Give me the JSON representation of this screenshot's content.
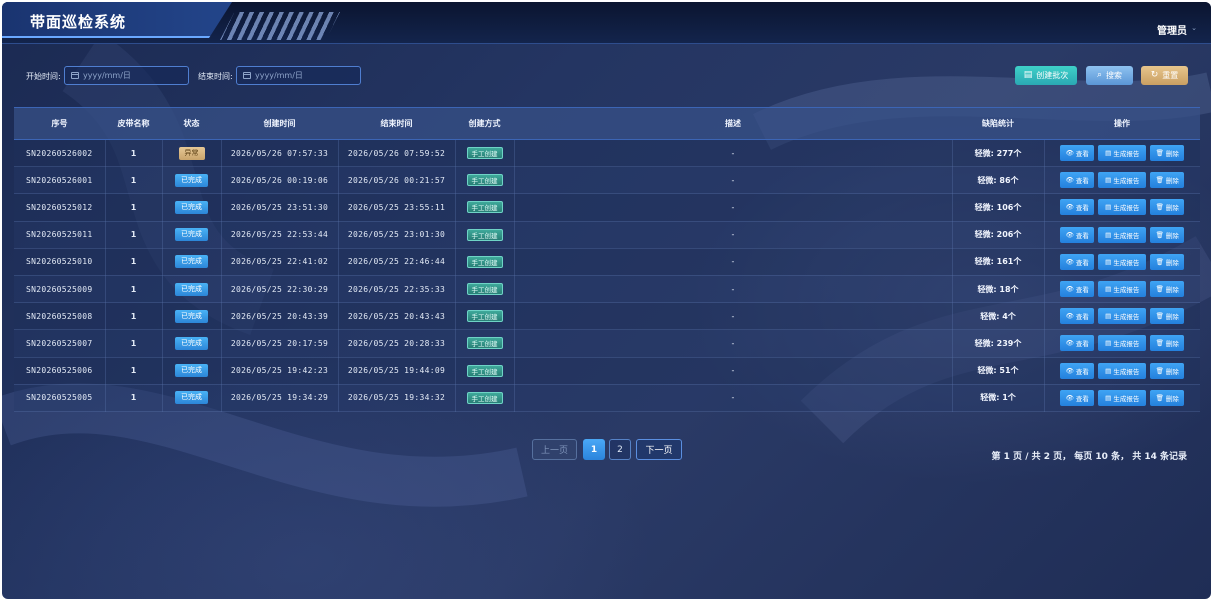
{
  "header": {
    "title": "带面巡检系统",
    "user": "管理员"
  },
  "filters": {
    "start_label": "开始时间:",
    "start_placeholder": "yyyy/mm/日",
    "end_label": "结束时间:",
    "end_placeholder": "yyyy/mm/日"
  },
  "toolbar": {
    "create_label": "创建批次",
    "search_label": "搜索",
    "reset_label": "重置"
  },
  "table": {
    "columns": [
      "序号",
      "皮带名称",
      "状态",
      "创建时间",
      "结束时间",
      "创建方式",
      "描述",
      "缺陷统计",
      "操作"
    ],
    "rows": [
      {
        "id": "SN20260526002",
        "belt": "1",
        "status": "异常",
        "status_type": "error",
        "created": "2026/05/26 07:57:33",
        "ended": "2026/05/26 07:59:52",
        "method": "手工创建",
        "desc": "-",
        "defects": "轻微: 277个"
      },
      {
        "id": "SN20260526001",
        "belt": "1",
        "status": "已完成",
        "status_type": "done",
        "created": "2026/05/26 00:19:06",
        "ended": "2026/05/26 00:21:57",
        "method": "手工创建",
        "desc": "-",
        "defects": "轻微: 86个"
      },
      {
        "id": "SN20260525012",
        "belt": "1",
        "status": "已完成",
        "status_type": "done",
        "created": "2026/05/25 23:51:30",
        "ended": "2026/05/25 23:55:11",
        "method": "手工创建",
        "desc": "-",
        "defects": "轻微: 106个"
      },
      {
        "id": "SN20260525011",
        "belt": "1",
        "status": "已完成",
        "status_type": "done",
        "created": "2026/05/25 22:53:44",
        "ended": "2026/05/25 23:01:30",
        "method": "手工创建",
        "desc": "-",
        "defects": "轻微: 206个"
      },
      {
        "id": "SN20260525010",
        "belt": "1",
        "status": "已完成",
        "status_type": "done",
        "created": "2026/05/25 22:41:02",
        "ended": "2026/05/25 22:46:44",
        "method": "手工创建",
        "desc": "-",
        "defects": "轻微: 161个"
      },
      {
        "id": "SN20260525009",
        "belt": "1",
        "status": "已完成",
        "status_type": "done",
        "created": "2026/05/25 22:30:29",
        "ended": "2026/05/25 22:35:33",
        "method": "手工创建",
        "desc": "-",
        "defects": "轻微: 18个"
      },
      {
        "id": "SN20260525008",
        "belt": "1",
        "status": "已完成",
        "status_type": "done",
        "created": "2026/05/25 20:43:39",
        "ended": "2026/05/25 20:43:43",
        "method": "手工创建",
        "desc": "-",
        "defects": "轻微: 4个"
      },
      {
        "id": "SN20260525007",
        "belt": "1",
        "status": "已完成",
        "status_type": "done",
        "created": "2026/05/25 20:17:59",
        "ended": "2026/05/25 20:28:33",
        "method": "手工创建",
        "desc": "-",
        "defects": "轻微: 239个"
      },
      {
        "id": "SN20260525006",
        "belt": "1",
        "status": "已完成",
        "status_type": "done",
        "created": "2026/05/25 19:42:23",
        "ended": "2026/05/25 19:44:09",
        "method": "手工创建",
        "desc": "-",
        "defects": "轻微: 51个"
      },
      {
        "id": "SN20260525005",
        "belt": "1",
        "status": "已完成",
        "status_type": "done",
        "created": "2026/05/25 19:34:29",
        "ended": "2026/05/25 19:34:32",
        "method": "手工创建",
        "desc": "-",
        "defects": "轻微: 1个"
      }
    ],
    "actions": {
      "view": "查看",
      "report": "生成报告",
      "delete": "删除"
    }
  },
  "pagination": {
    "prev": "上一页",
    "pages": [
      "1",
      "2"
    ],
    "current": "1",
    "next": "下一页",
    "info": "第 1 页 / 共 2 页， 每页 10 条， 共 14 条记录"
  },
  "colors": {
    "accent": "#2b84dc",
    "status_done": "#3a9cea",
    "status_error": "#d8b47d",
    "tag_manual": "#3ea99a"
  }
}
